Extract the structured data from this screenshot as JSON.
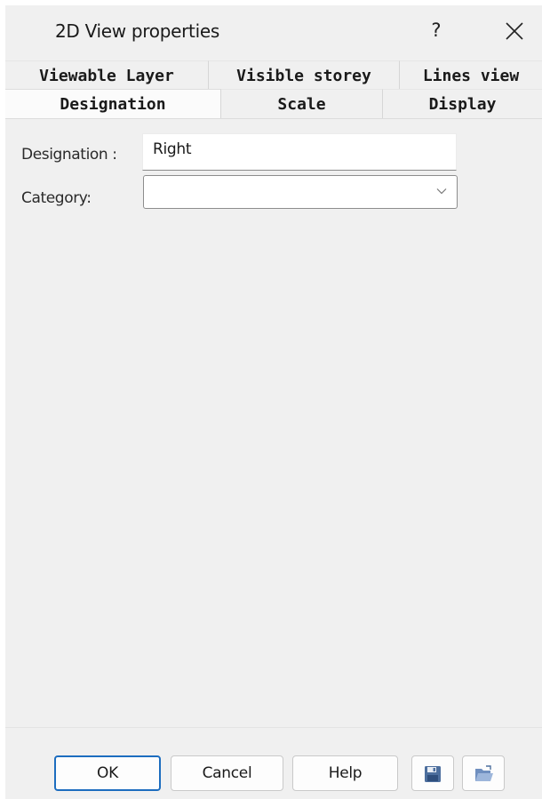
{
  "window": {
    "title": "2D View properties",
    "help_label": "?",
    "close_icon": "close-icon"
  },
  "tabs": {
    "row1": [
      {
        "label": "Viewable Layer"
      },
      {
        "label": "Visible storey"
      },
      {
        "label": "Lines view"
      }
    ],
    "row2": [
      {
        "label": "Designation",
        "active": true
      },
      {
        "label": "Scale"
      },
      {
        "label": "Display"
      }
    ]
  },
  "form": {
    "designation_label": "Designation :",
    "designation_value": "Right",
    "category_label": "Category:",
    "category_value": ""
  },
  "buttons": {
    "ok": "OK",
    "cancel": "Cancel",
    "help": "Help",
    "save_icon": "save-icon",
    "open_icon": "open-icon"
  },
  "colors": {
    "background": "#f0f0f0",
    "accent": "#1d6dbf"
  }
}
